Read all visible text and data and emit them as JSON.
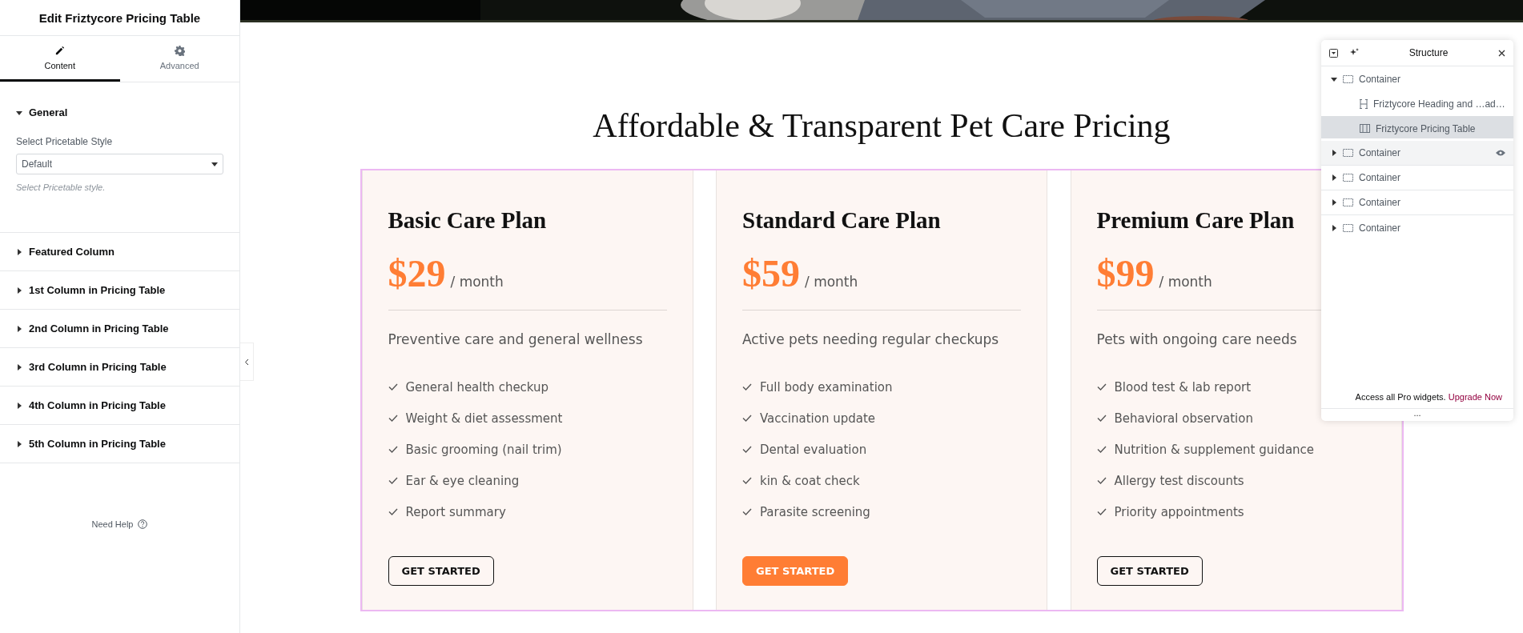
{
  "editor": {
    "title": "Edit Friztycore Pricing Table",
    "tabs": [
      {
        "label": "Content",
        "selected": true
      },
      {
        "label": "Advanced",
        "selected": false
      }
    ],
    "sections": [
      {
        "title": "General",
        "expanded": true,
        "field": {
          "label": "Select Pricetable Style",
          "value": "Default",
          "hint": "Select Pricetable style."
        }
      },
      {
        "title": "Featured Column",
        "expanded": false
      },
      {
        "title": "1st Column in Pricing Table",
        "expanded": false
      },
      {
        "title": "2nd Column in Pricing Table",
        "expanded": false
      },
      {
        "title": "3rd Column in Pricing Table",
        "expanded": false
      },
      {
        "title": "4th Column in Pricing Table",
        "expanded": false
      },
      {
        "title": "5th Column in Pricing Table",
        "expanded": false
      }
    ],
    "help": "Need Help"
  },
  "page": {
    "heading": "Affordable & Transparent Pet Care Pricing",
    "plans": [
      {
        "name": "Basic Care Plan",
        "currency": "$",
        "price": "29",
        "period": "/ month",
        "description": "Preventive care and general wellness",
        "features": [
          "General health checkup",
          "Weight & diet assessment",
          "Basic grooming (nail trim)",
          "Ear & eye cleaning",
          "Report summary"
        ],
        "button": "GET STARTED",
        "featured": false
      },
      {
        "name": "Standard Care Plan",
        "currency": "$",
        "price": "59",
        "period": "/ month",
        "description": "Active pets needing regular checkups",
        "features": [
          "Full body examination",
          "Vaccination update",
          "Dental evaluation",
          "kin & coat check",
          "Parasite screening"
        ],
        "button": "GET STARTED",
        "featured": true
      },
      {
        "name": "Premium Care Plan",
        "currency": "$",
        "price": "99",
        "period": "/ month",
        "description": "Pets with ongoing care needs",
        "features": [
          "Blood test & lab report",
          "Behavioral observation",
          "Nutrition & supplement guidance",
          "Allergy test discounts",
          "Priority appointments"
        ],
        "button": "GET STARTED",
        "featured": false
      }
    ]
  },
  "structure": {
    "title": "Structure",
    "items": [
      {
        "label": "Container",
        "kind": "container",
        "expanded": true,
        "selected": false,
        "highlighted": false,
        "children": [
          {
            "label": "Friztycore Heading and …ad…",
            "kind": "heading",
            "selected": false,
            "highlighted": false
          },
          {
            "label": "Friztycore Pricing Table",
            "kind": "table",
            "selected": true,
            "highlighted": false
          }
        ]
      },
      {
        "label": "Container",
        "kind": "container",
        "expanded": false,
        "selected": false,
        "highlighted": true
      },
      {
        "label": "Container",
        "kind": "container",
        "expanded": false,
        "selected": false,
        "highlighted": false
      },
      {
        "label": "Container",
        "kind": "container",
        "expanded": false,
        "selected": false,
        "highlighted": false
      },
      {
        "label": "Container",
        "kind": "container",
        "expanded": false,
        "selected": false,
        "highlighted": false
      }
    ],
    "footer": {
      "text": "Access all Pro widgets.",
      "link": "Upgrade Now"
    },
    "more": "..."
  }
}
